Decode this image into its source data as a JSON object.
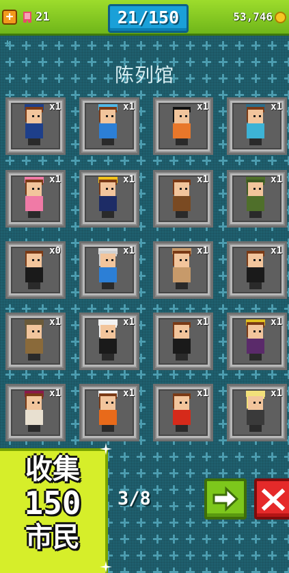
{
  "header": {
    "gem_count": "21",
    "population": "21/150",
    "coins": "53,746"
  },
  "gallery": {
    "title": "陈列馆"
  },
  "cards": [
    {
      "count": "x1",
      "hair": "#7a3a16",
      "top": "#1e3f8a",
      "hat": "#1e3f8a"
    },
    {
      "count": "x1",
      "hair": "#7a3a16",
      "top": "#2c7fd6",
      "hat": "#4fb8e8"
    },
    {
      "count": "x1",
      "hair": "#111111",
      "top": "#e8772a",
      "hat": ""
    },
    {
      "count": "x1",
      "hair": "#7a3a16",
      "top": "#3db3d6",
      "hat": "#2c6d8a"
    },
    {
      "count": "x1",
      "hair": "#7a3a16",
      "top": "#f07aa6",
      "hat": "#f07aa6"
    },
    {
      "count": "x1",
      "hair": "#7a3a16",
      "top": "#1d2c66",
      "hat": "#f2c21a"
    },
    {
      "count": "x1",
      "hair": "#7a3a16",
      "top": "#7a4a22",
      "hat": ""
    },
    {
      "count": "x1",
      "hair": "#3d5a22",
      "top": "#4f6f2a",
      "hat": "#4f6f2a"
    },
    {
      "count": "x0",
      "hair": "#7a3a16",
      "top": "#1a1a1a",
      "hat": ""
    },
    {
      "count": "x1",
      "hair": "#d0d0d0",
      "top": "#2c7fd6",
      "hat": "#e0e0e0"
    },
    {
      "count": "x1",
      "hair": "#7a3a16",
      "top": "#c79a6a",
      "hat": "#c79a6a"
    },
    {
      "count": "x1",
      "hair": "#7a3a16",
      "top": "#1a1a1a",
      "hat": ""
    },
    {
      "count": "x1",
      "hair": "#6a5a3a",
      "top": "#8a6a3a",
      "hat": "#6a5a3a"
    },
    {
      "count": "x1",
      "hair": "#f2f2f2",
      "top": "#1a1a1a",
      "hat": "#f2f2f2"
    },
    {
      "count": "x1",
      "hair": "#7a3a16",
      "top": "#1a1a1a",
      "hat": ""
    },
    {
      "count": "x1",
      "hair": "#7a3a16",
      "top": "#5a2a6a",
      "hat": "#e0c020"
    },
    {
      "count": "x1",
      "hair": "#7a3a16",
      "top": "#e8e0d0",
      "hat": "#8a1a4a"
    },
    {
      "count": "x1",
      "hair": "#7a3a16",
      "top": "#e86a1a",
      "hat": "#f2f2f2"
    },
    {
      "count": "x1",
      "hair": "#7a3a16",
      "top": "#d62a1a",
      "hat": ""
    },
    {
      "count": "x1",
      "hair": "#f2e07a",
      "top": "#3a3a3a",
      "hat": "#f2e07a"
    }
  ],
  "banner": {
    "line1": "收集",
    "line2": "150",
    "line3": "市民"
  },
  "pagination": {
    "page": "3/8"
  }
}
